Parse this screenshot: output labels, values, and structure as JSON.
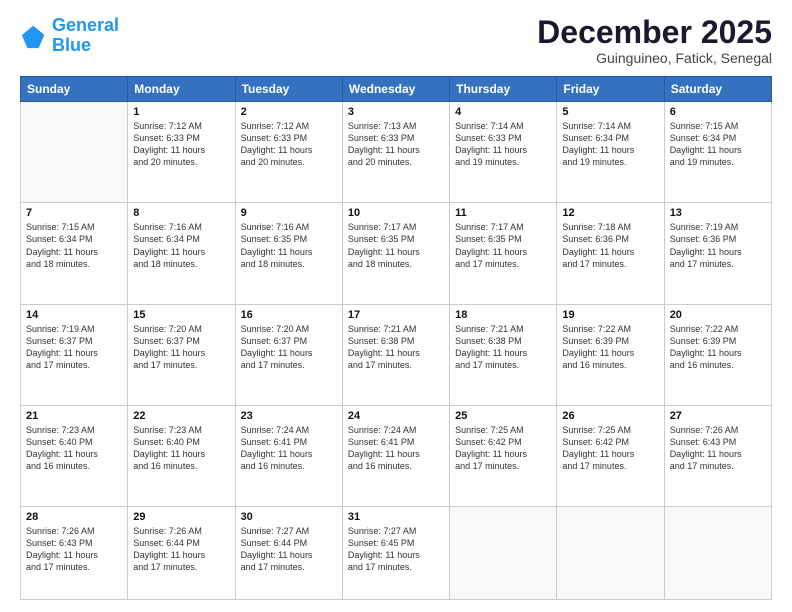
{
  "logo": {
    "line1": "General",
    "line2": "Blue"
  },
  "header": {
    "month": "December 2025",
    "location": "Guinguineo, Fatick, Senegal"
  },
  "days_of_week": [
    "Sunday",
    "Monday",
    "Tuesday",
    "Wednesday",
    "Thursday",
    "Friday",
    "Saturday"
  ],
  "weeks": [
    [
      {
        "day": "",
        "info": ""
      },
      {
        "day": "1",
        "info": "Sunrise: 7:12 AM\nSunset: 6:33 PM\nDaylight: 11 hours\nand 20 minutes."
      },
      {
        "day": "2",
        "info": "Sunrise: 7:12 AM\nSunset: 6:33 PM\nDaylight: 11 hours\nand 20 minutes."
      },
      {
        "day": "3",
        "info": "Sunrise: 7:13 AM\nSunset: 6:33 PM\nDaylight: 11 hours\nand 20 minutes."
      },
      {
        "day": "4",
        "info": "Sunrise: 7:14 AM\nSunset: 6:33 PM\nDaylight: 11 hours\nand 19 minutes."
      },
      {
        "day": "5",
        "info": "Sunrise: 7:14 AM\nSunset: 6:34 PM\nDaylight: 11 hours\nand 19 minutes."
      },
      {
        "day": "6",
        "info": "Sunrise: 7:15 AM\nSunset: 6:34 PM\nDaylight: 11 hours\nand 19 minutes."
      }
    ],
    [
      {
        "day": "7",
        "info": "Sunrise: 7:15 AM\nSunset: 6:34 PM\nDaylight: 11 hours\nand 18 minutes."
      },
      {
        "day": "8",
        "info": "Sunrise: 7:16 AM\nSunset: 6:34 PM\nDaylight: 11 hours\nand 18 minutes."
      },
      {
        "day": "9",
        "info": "Sunrise: 7:16 AM\nSunset: 6:35 PM\nDaylight: 11 hours\nand 18 minutes."
      },
      {
        "day": "10",
        "info": "Sunrise: 7:17 AM\nSunset: 6:35 PM\nDaylight: 11 hours\nand 18 minutes."
      },
      {
        "day": "11",
        "info": "Sunrise: 7:17 AM\nSunset: 6:35 PM\nDaylight: 11 hours\nand 17 minutes."
      },
      {
        "day": "12",
        "info": "Sunrise: 7:18 AM\nSunset: 6:36 PM\nDaylight: 11 hours\nand 17 minutes."
      },
      {
        "day": "13",
        "info": "Sunrise: 7:19 AM\nSunset: 6:36 PM\nDaylight: 11 hours\nand 17 minutes."
      }
    ],
    [
      {
        "day": "14",
        "info": "Sunrise: 7:19 AM\nSunset: 6:37 PM\nDaylight: 11 hours\nand 17 minutes."
      },
      {
        "day": "15",
        "info": "Sunrise: 7:20 AM\nSunset: 6:37 PM\nDaylight: 11 hours\nand 17 minutes."
      },
      {
        "day": "16",
        "info": "Sunrise: 7:20 AM\nSunset: 6:37 PM\nDaylight: 11 hours\nand 17 minutes."
      },
      {
        "day": "17",
        "info": "Sunrise: 7:21 AM\nSunset: 6:38 PM\nDaylight: 11 hours\nand 17 minutes."
      },
      {
        "day": "18",
        "info": "Sunrise: 7:21 AM\nSunset: 6:38 PM\nDaylight: 11 hours\nand 17 minutes."
      },
      {
        "day": "19",
        "info": "Sunrise: 7:22 AM\nSunset: 6:39 PM\nDaylight: 11 hours\nand 16 minutes."
      },
      {
        "day": "20",
        "info": "Sunrise: 7:22 AM\nSunset: 6:39 PM\nDaylight: 11 hours\nand 16 minutes."
      }
    ],
    [
      {
        "day": "21",
        "info": "Sunrise: 7:23 AM\nSunset: 6:40 PM\nDaylight: 11 hours\nand 16 minutes."
      },
      {
        "day": "22",
        "info": "Sunrise: 7:23 AM\nSunset: 6:40 PM\nDaylight: 11 hours\nand 16 minutes."
      },
      {
        "day": "23",
        "info": "Sunrise: 7:24 AM\nSunset: 6:41 PM\nDaylight: 11 hours\nand 16 minutes."
      },
      {
        "day": "24",
        "info": "Sunrise: 7:24 AM\nSunset: 6:41 PM\nDaylight: 11 hours\nand 16 minutes."
      },
      {
        "day": "25",
        "info": "Sunrise: 7:25 AM\nSunset: 6:42 PM\nDaylight: 11 hours\nand 17 minutes."
      },
      {
        "day": "26",
        "info": "Sunrise: 7:25 AM\nSunset: 6:42 PM\nDaylight: 11 hours\nand 17 minutes."
      },
      {
        "day": "27",
        "info": "Sunrise: 7:26 AM\nSunset: 6:43 PM\nDaylight: 11 hours\nand 17 minutes."
      }
    ],
    [
      {
        "day": "28",
        "info": "Sunrise: 7:26 AM\nSunset: 6:43 PM\nDaylight: 11 hours\nand 17 minutes."
      },
      {
        "day": "29",
        "info": "Sunrise: 7:26 AM\nSunset: 6:44 PM\nDaylight: 11 hours\nand 17 minutes."
      },
      {
        "day": "30",
        "info": "Sunrise: 7:27 AM\nSunset: 6:44 PM\nDaylight: 11 hours\nand 17 minutes."
      },
      {
        "day": "31",
        "info": "Sunrise: 7:27 AM\nSunset: 6:45 PM\nDaylight: 11 hours\nand 17 minutes."
      },
      {
        "day": "",
        "info": ""
      },
      {
        "day": "",
        "info": ""
      },
      {
        "day": "",
        "info": ""
      }
    ]
  ]
}
